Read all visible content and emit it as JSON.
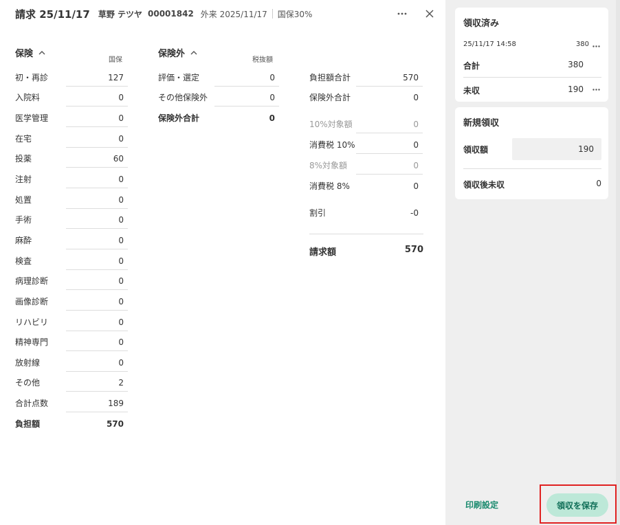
{
  "header": {
    "title": "請求 25/11/17",
    "patient_name": "草野 テツヤ",
    "patient_id": "00001842",
    "visit": "外来 2025/11/17",
    "insurance": "国保30%"
  },
  "insured": {
    "title": "保険",
    "column_head": "国保",
    "rows": [
      {
        "label": "初・再診",
        "value": "127"
      },
      {
        "label": "入院料",
        "value": "0"
      },
      {
        "label": "医学管理",
        "value": "0"
      },
      {
        "label": "在宅",
        "value": "0"
      },
      {
        "label": "投薬",
        "value": "60"
      },
      {
        "label": "注射",
        "value": "0"
      },
      {
        "label": "処置",
        "value": "0"
      },
      {
        "label": "手術",
        "value": "0"
      },
      {
        "label": "麻酔",
        "value": "0"
      },
      {
        "label": "検査",
        "value": "0"
      },
      {
        "label": "病理診断",
        "value": "0"
      },
      {
        "label": "画像診断",
        "value": "0"
      },
      {
        "label": "リハビリ",
        "value": "0"
      },
      {
        "label": "精神専門",
        "value": "0"
      },
      {
        "label": "放射線",
        "value": "0"
      },
      {
        "label": "その他",
        "value": "2"
      },
      {
        "label": "合計点数",
        "value": "189"
      },
      {
        "label": "負担額",
        "value": "570"
      }
    ]
  },
  "uninsured": {
    "title": "保険外",
    "column_head": "税抜額",
    "rows": [
      {
        "label": "評価・選定",
        "value": "0"
      },
      {
        "label": "その他保険外",
        "value": "0"
      },
      {
        "label": "保険外合計",
        "value": "0"
      }
    ]
  },
  "summary": {
    "rows": [
      {
        "label": "負担額合計",
        "value": "570"
      },
      {
        "label": "保険外合計",
        "value": "0"
      },
      {
        "label": "10%対象額",
        "value": "0"
      },
      {
        "label": "消費税 10%",
        "value": "0"
      },
      {
        "label": "8%対象額",
        "value": "0"
      },
      {
        "label": "消費税 8%",
        "value": "0"
      },
      {
        "label": "割引",
        "value": "-0"
      }
    ],
    "total_label": "請求額",
    "total_value": "570"
  },
  "received": {
    "title": "領収済み",
    "entry_date": "25/11/17 14:58",
    "entry_amount": "380",
    "total_label": "合計",
    "total_value": "380",
    "unpaid_label": "未収",
    "unpaid_value": "190"
  },
  "new_receipt": {
    "title": "新規領収",
    "amount_label": "領収額",
    "amount_value": "190",
    "after_label": "領収後未収",
    "after_value": "0"
  },
  "footer": {
    "print_label": "印刷設定",
    "save_label": "領収を保存"
  },
  "icons": {
    "more": "more-icon",
    "close": "close-icon",
    "collapse": "chevron-up-icon"
  },
  "colors": {
    "accent": "#1a8a6e",
    "save_button_bg": "#bde8d8",
    "highlight": "#e02020"
  }
}
